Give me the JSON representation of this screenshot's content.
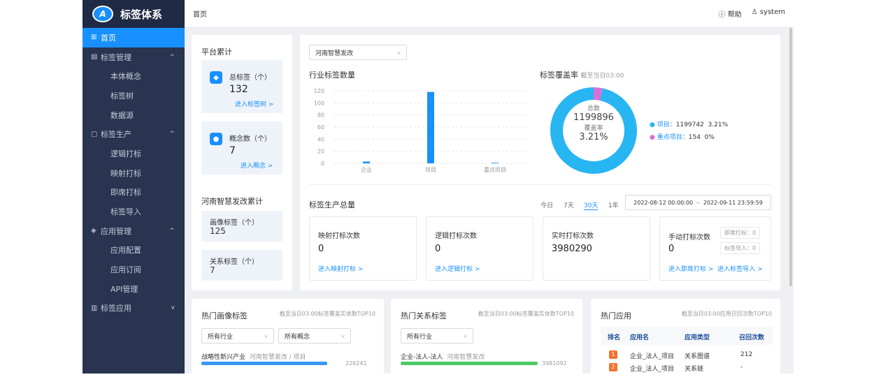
{
  "app": {
    "title": "标签体系",
    "logo_text": "A",
    "breadcrumb": "首页",
    "help": "帮助",
    "user": "system"
  },
  "sidebar": {
    "home": "首页",
    "groups": [
      {
        "label": "标签管理",
        "items": [
          "本体概念",
          "标签树",
          "数据源"
        ]
      },
      {
        "label": "标签生产",
        "items": [
          "逻辑打标",
          "映射打标",
          "即席打标",
          "标签导入"
        ]
      },
      {
        "label": "应用管理",
        "items": [
          "应用配置",
          "应用订阅",
          "API管理"
        ]
      },
      {
        "label": "标签应用",
        "items": []
      }
    ]
  },
  "platform": {
    "title": "平台累计",
    "total_tags": {
      "label": "总标签（个）",
      "value": "132",
      "link": "进入标签树 >"
    },
    "concepts": {
      "label": "概念数（个）",
      "value": "7",
      "link": "进入概念 >"
    }
  },
  "henan": {
    "title": "河南智慧发改累计",
    "portrait": {
      "label": "画像标签（个）",
      "value": "125"
    },
    "relation": {
      "label": "关系标签（个）",
      "value": "7"
    }
  },
  "industry": {
    "select": "河南智慧发改",
    "title": "行业标签数量",
    "chart_data": {
      "type": "bar",
      "categories": [
        "企业",
        "项目",
        "重点项目"
      ],
      "values": [
        3,
        118,
        1
      ],
      "ylim": [
        0,
        120
      ],
      "yticks": [
        "120",
        "100",
        "80",
        "60",
        "40",
        "20",
        "0"
      ],
      "color": "#1890ff"
    }
  },
  "coverage": {
    "title": "标签覆盖率",
    "note": "截至当日03:00",
    "total_label": "总数",
    "total": "1199896",
    "rate_label": "覆盖率",
    "rate": "3.21%",
    "legend": [
      {
        "label": "项目：",
        "count": "1199742",
        "pct": "3.21%",
        "color": "#27b6f2"
      },
      {
        "label": "重点项目：",
        "count": "154",
        "pct": "0%",
        "color": "#d770d8"
      }
    ],
    "chart_data": {
      "type": "pie",
      "labels": [
        "项目",
        "重点项目"
      ],
      "values": [
        96.7,
        3.3
      ]
    }
  },
  "production": {
    "title": "标签生产总量",
    "tabs": [
      "今日",
      "7天",
      "30天",
      "1年"
    ],
    "active_tab": "30天",
    "start": "2022-08-12 00:00:00",
    "sep": "~",
    "end": "2022-09-11 23:59:59",
    "stats": [
      {
        "title": "映射打标次数",
        "value": "0",
        "link": "进入映射打标 >"
      },
      {
        "title": "逻辑打标次数",
        "value": "0",
        "link": "进入逻辑打标 >"
      },
      {
        "title": "实时打标次数",
        "value": "3980290",
        "link": ""
      },
      {
        "title": "手动打标次数",
        "value": "0",
        "link": "进入即席打标 >",
        "link2": "进入标签导入 >",
        "mini1": "即席打标：0",
        "mini2": "标签导入：0"
      }
    ]
  },
  "hot_portrait": {
    "title": "热门画像标签",
    "note": "截至当日03:00标签覆盖实体数TOP10",
    "select1": "所有行业",
    "select2": "所有概念",
    "row_label": "战略性新兴产业",
    "row_sub": "河南智慧发改 / 项目",
    "row_value": "226241",
    "row_fraction": 0.92,
    "bar_color": "#3c97f0"
  },
  "hot_relation": {
    "title": "热门关系标签",
    "note": "截至当日03:00标签覆盖实体数TOP10",
    "select1": "所有行业",
    "row_label": "企业-法人-法人",
    "row_sub": "河南智慧发改",
    "row_value": "3981092",
    "row_fraction": 1.0,
    "bar_color": "#4fc966"
  },
  "hot_apps": {
    "title": "热门应用",
    "note": "截至当日03:00应用召回次数TOP10",
    "headers": [
      "排名",
      "应用名",
      "应用类型",
      "召回次数"
    ],
    "rows": [
      {
        "rank": "1",
        "name": "企业_法人_项目",
        "type": "关系图谱",
        "count": "212"
      },
      {
        "rank": "2",
        "name": "企业_法人_项目",
        "type": "关系链",
        "count": "-"
      }
    ]
  }
}
